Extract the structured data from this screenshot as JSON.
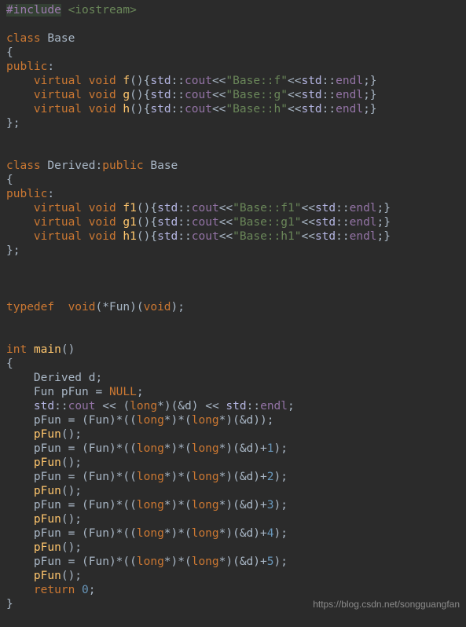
{
  "code": {
    "include_prefix": "#include",
    "include_header": "<iostream>",
    "kw_class": "class",
    "base_name": "Base",
    "brace_open": "{",
    "brace_close": "}",
    "kw_public": "public",
    "colon": ":",
    "kw_virtual": "virtual",
    "kw_void": "void",
    "kw_int": "int",
    "kw_return": "return",
    "kw_typedef": "typedef",
    "fn_f": "f",
    "fn_g": "g",
    "fn_h": "h",
    "fn_f1": "f1",
    "fn_g1": "g1",
    "fn_h1": "h1",
    "fn_main": "main",
    "fn_pFun": "pFun",
    "std": "std",
    "dcolon": "::",
    "cout": "cout",
    "endl": "endl",
    "shl": "<<",
    "str_f": "\"Base::f\"",
    "str_g": "\"Base::g\"",
    "str_h": "\"Base::h\"",
    "str_f1": "\"Base::f1\"",
    "str_g1": "\"Base::g1\"",
    "str_h1": "\"Base::h1\"",
    "derived_name": "Derived",
    "long": "long",
    "null": "NULL",
    "n0": "0",
    "n1": "1",
    "n2": "2",
    "n3": "3",
    "n4": "4",
    "n5": "5",
    "fun_ptr_decl": "(*Fun)(",
    "vdecl_d": "Derived d;",
    "vdecl_pfun": "Fun pFun = ",
    "semicolon": ";",
    "paren_open": "(",
    "paren_close": ")",
    "emptycall": "()",
    "addr_d": "(&d)",
    "cast_fun": "(Fun)",
    "star": "*",
    "amp_d": "&d",
    "plus": "+",
    "eq": " = ",
    "space": " "
  },
  "watermark": "https://blog.csdn.net/songguangfan"
}
